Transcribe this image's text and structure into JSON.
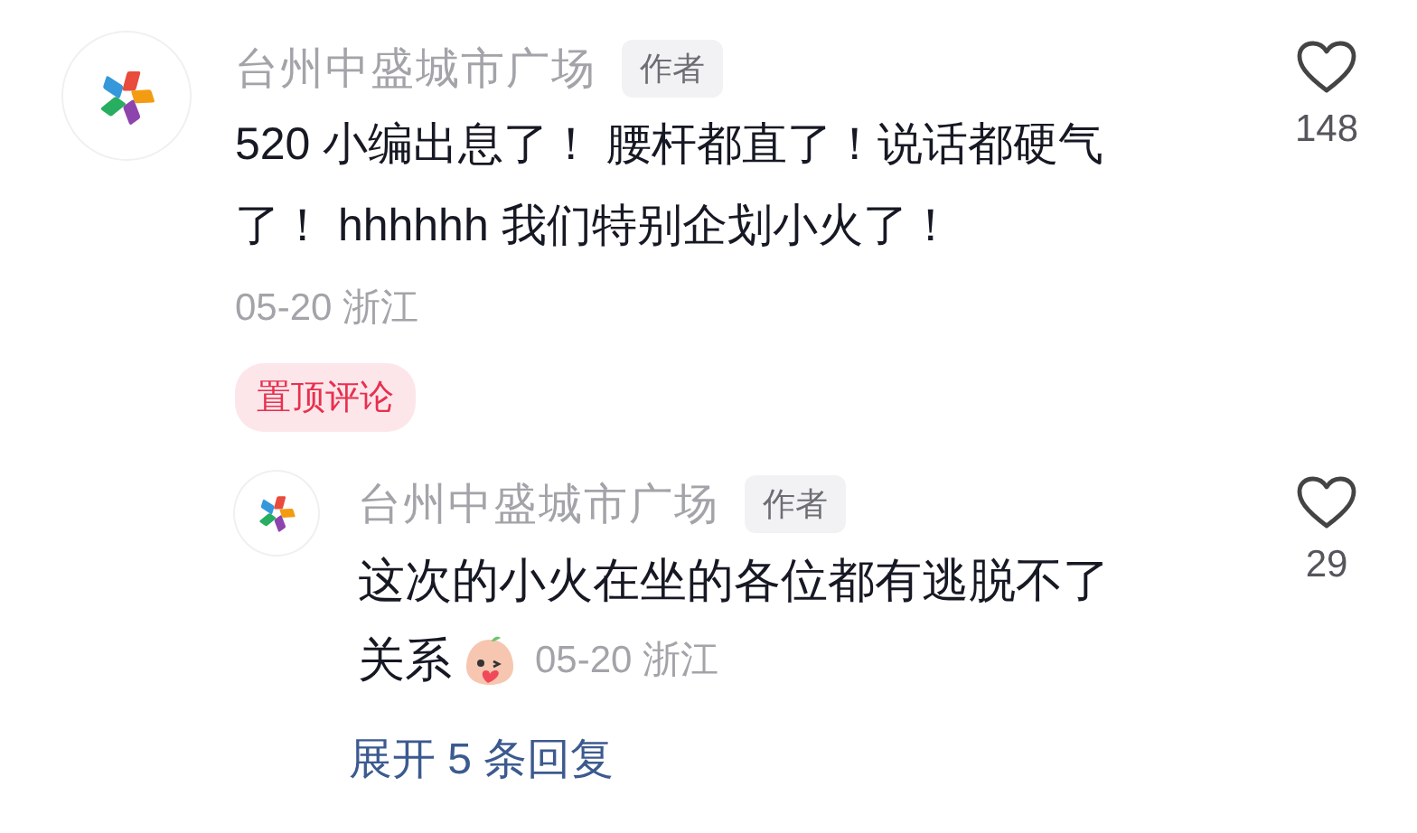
{
  "comment": {
    "author": "台州中盛城市广场",
    "badge": "作者",
    "text": "520 小编出息了！ 腰杆都直了！说话都硬气了！ hhhhhh 我们特别企划小火了！",
    "date": "05-20",
    "location": "浙江",
    "pinned_label": "置顶评论",
    "likes": "148",
    "liked": false
  },
  "reply": {
    "author": "台州中盛城市广场",
    "badge": "作者",
    "text": "这次的小火在坐的各位都有逃脱不了关系",
    "sticker": true,
    "date": "05-20",
    "location": "浙江",
    "likes": "29",
    "liked": false
  },
  "expand_replies": "展开 5 条回复"
}
